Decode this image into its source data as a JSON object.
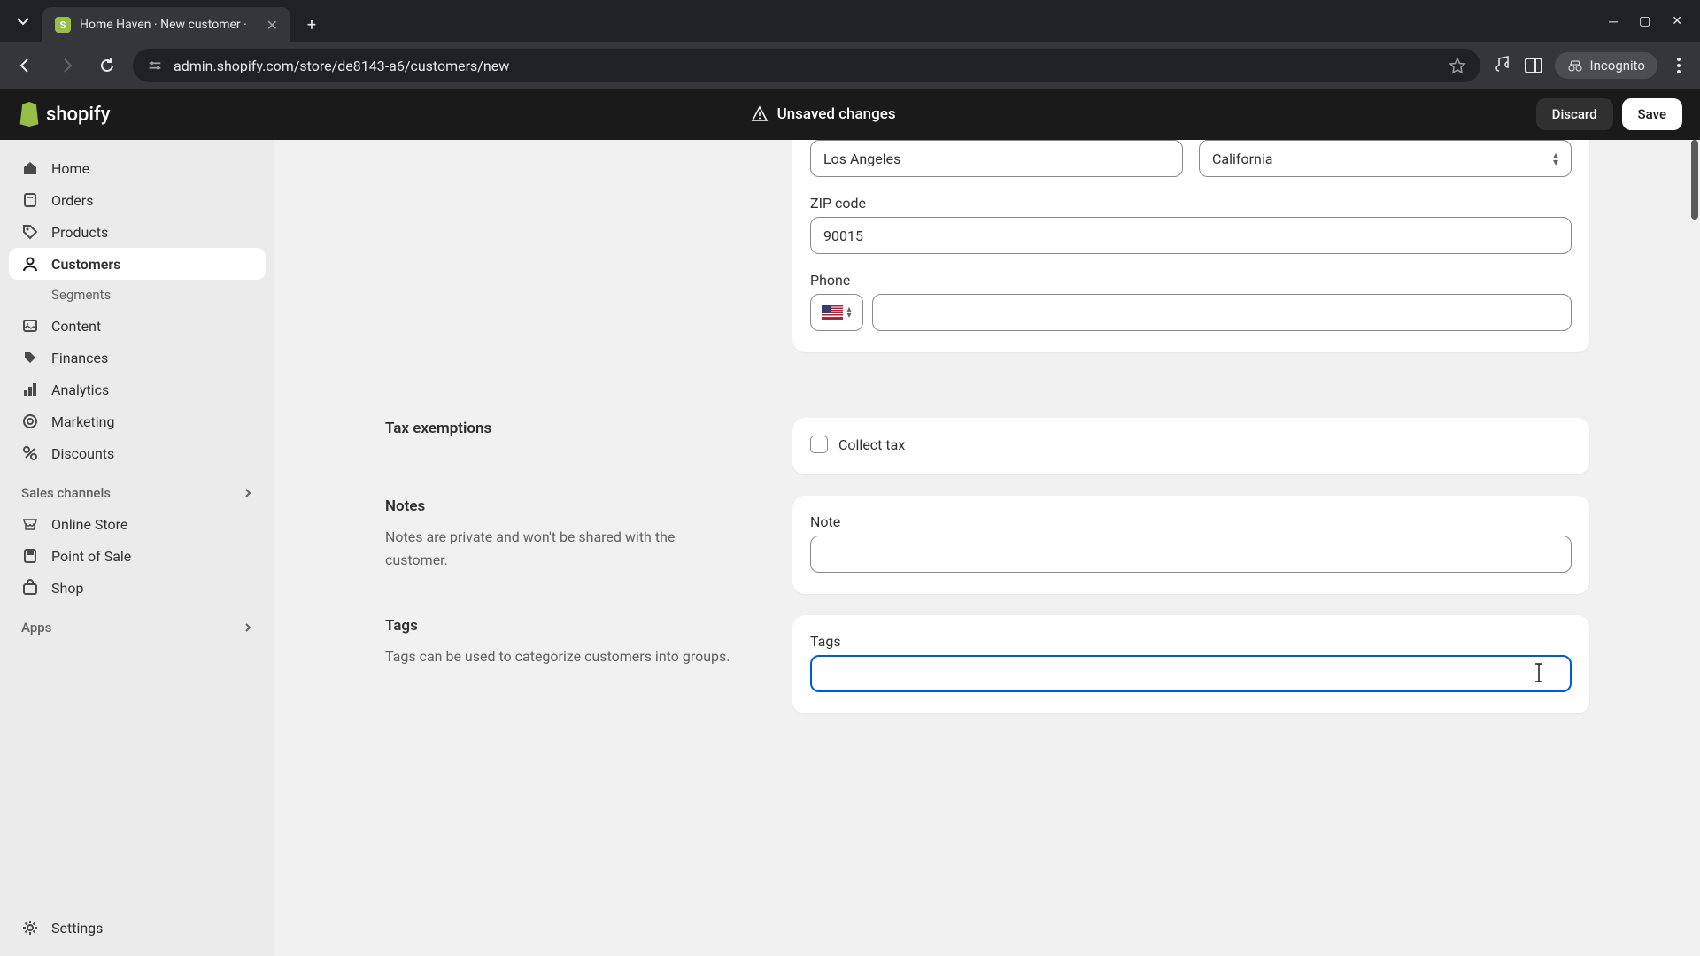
{
  "browser": {
    "tab_title": "Home Haven · New customer ·",
    "url": "admin.shopify.com/store/de8143-a6/customers/new",
    "incognito_label": "Incognito"
  },
  "header": {
    "logo_text": "shopify",
    "unsaved_label": "Unsaved changes",
    "discard_label": "Discard",
    "save_label": "Save"
  },
  "sidebar": {
    "items": [
      {
        "label": "Home"
      },
      {
        "label": "Orders"
      },
      {
        "label": "Products"
      },
      {
        "label": "Customers"
      },
      {
        "label": "Segments"
      },
      {
        "label": "Content"
      },
      {
        "label": "Finances"
      },
      {
        "label": "Analytics"
      },
      {
        "label": "Marketing"
      },
      {
        "label": "Discounts"
      }
    ],
    "sales_channels_label": "Sales channels",
    "channels": [
      {
        "label": "Online Store"
      },
      {
        "label": "Point of Sale"
      },
      {
        "label": "Shop"
      }
    ],
    "apps_label": "Apps",
    "settings_label": "Settings"
  },
  "form": {
    "address": {
      "city_value": "Los Angeles",
      "state_value": "California",
      "zip_label": "ZIP code",
      "zip_value": "90015",
      "phone_label": "Phone",
      "phone_value": ""
    },
    "tax": {
      "title": "Tax exemptions",
      "collect_label": "Collect tax"
    },
    "notes": {
      "title": "Notes",
      "description": "Notes are private and won't be shared with the customer.",
      "label": "Note",
      "value": ""
    },
    "tags": {
      "title": "Tags",
      "description": "Tags can be used to categorize customers into groups.",
      "label": "Tags",
      "value": ""
    }
  }
}
